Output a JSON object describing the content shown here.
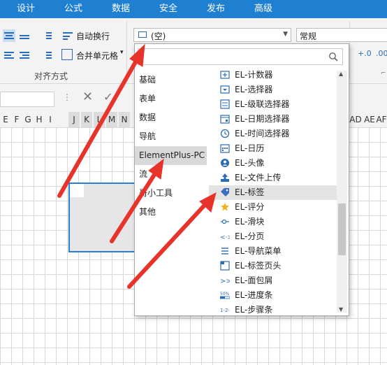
{
  "tabs": [
    "设计",
    "公式",
    "数据",
    "安全",
    "发布",
    "高级"
  ],
  "ribbon": {
    "auto_wrap": "自动换行",
    "merge_cells": "合并单元格",
    "align_group": "对齐方式",
    "cell_style_value": "(空)",
    "number_format_value": "常规"
  },
  "columns": [
    "E",
    "F",
    "G",
    "H",
    "I",
    "J",
    "K",
    "L",
    "M",
    "N",
    "AD",
    "AE",
    "AF"
  ],
  "popup": {
    "categories": [
      {
        "label": "基础",
        "selected": false
      },
      {
        "label": "表单",
        "selected": false
      },
      {
        "label": "数据",
        "selected": false
      },
      {
        "label": "导航",
        "selected": false
      },
      {
        "label": "ElementPlus-PC",
        "selected": true
      },
      {
        "label": "流",
        "selected": false
      },
      {
        "label": "哥小工具",
        "selected": false
      },
      {
        "label": "其他",
        "selected": false
      }
    ],
    "items": [
      {
        "label": "EL-计数器",
        "icon": "counter-icon"
      },
      {
        "label": "EL-选择器",
        "icon": "select-icon"
      },
      {
        "label": "EL-级联选择器",
        "icon": "cascader-icon"
      },
      {
        "label": "EL-日期选择器",
        "icon": "date-picker-icon"
      },
      {
        "label": "EL-时间选择器",
        "icon": "clock-icon"
      },
      {
        "label": "EL-日历",
        "icon": "calendar-icon"
      },
      {
        "label": "EL-头像",
        "icon": "avatar-icon"
      },
      {
        "label": "EL-文件上传",
        "icon": "upload-icon"
      },
      {
        "label": "EL-标签",
        "icon": "tag-icon",
        "selected": true
      },
      {
        "label": "EL-评分",
        "icon": "star-icon"
      },
      {
        "label": "EL-滑块",
        "icon": "slider-icon"
      },
      {
        "label": "EL-分页",
        "icon": "pagination-icon"
      },
      {
        "label": "EL-导航菜单",
        "icon": "nav-menu-icon"
      },
      {
        "label": "EL-标签页头",
        "icon": "tabs-icon"
      },
      {
        "label": "EL-面包屑",
        "icon": "breadcrumb-icon"
      },
      {
        "label": "EL-进度条",
        "icon": "progress-icon"
      },
      {
        "label": "EL-步骤条",
        "icon": "steps-icon"
      }
    ]
  },
  "colors": {
    "tab_bar": "#1f7fd0",
    "arrow": "#e8332a",
    "selection_border": "#2a7fd4",
    "icon_blue": "#2a6cb5"
  }
}
